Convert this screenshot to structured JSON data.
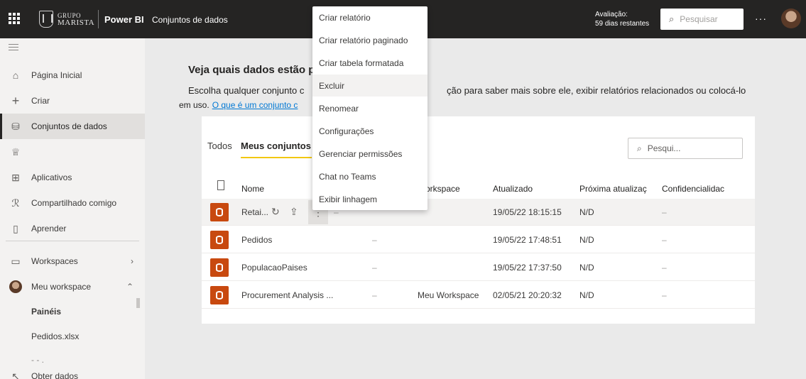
{
  "topbar": {
    "logo_line1": "GRUPO",
    "logo_line2": "MARISTA",
    "product": "Power BI",
    "breadcrumb": "Conjuntos de dados",
    "trial_line1": "Avaliação:",
    "trial_line2": "59 dias restantes",
    "search_placeholder": "Pesquisar",
    "more": "···"
  },
  "nav": {
    "items": [
      {
        "label": "Página Inicial"
      },
      {
        "label": "Criar"
      },
      {
        "label": "Conjuntos de dados"
      },
      {
        "label": ""
      },
      {
        "label": "Aplicativos"
      },
      {
        "label": "Compartilhado comigo"
      },
      {
        "label": "Aprender"
      },
      {
        "label": "Workspaces"
      },
      {
        "label": "Meu workspace"
      }
    ],
    "sub_items": [
      "Painéis",
      "Pedidos.xlsx",
      "- - ."
    ],
    "bottom": "Obter dados"
  },
  "main": {
    "title": "Veja quais dados estão p",
    "desc_part1": "Escolha qualquer conjunto c",
    "desc_part2": "ção para saber mais sobre ele, exibir relatórios relacionados ou colocá-lo",
    "desc_line2": "em uso.",
    "desc_link": "O que é um conjunto c",
    "tabs": [
      "Todos",
      "Meus conjuntos"
    ],
    "search_placeholder": "Pesqui...",
    "headers": {
      "name": "Nome",
      "workspace": "orkspace",
      "updated": "Atualizado",
      "next": "Próxima atualizaç",
      "sensitivity": "Confidencialidac"
    },
    "rows": [
      {
        "name": "Retai...",
        "owner": "–",
        "workspace": "",
        "updated": "19/05/22 18:15:15",
        "next": "N/D",
        "sensitivity": "–"
      },
      {
        "name": "Pedidos",
        "owner": "–",
        "workspace": "",
        "updated": "19/05/22 17:48:51",
        "next": "N/D",
        "sensitivity": "–"
      },
      {
        "name": "PopulacaoPaises",
        "owner": "–",
        "workspace": "",
        "updated": "19/05/22 17:37:50",
        "next": "N/D",
        "sensitivity": "–"
      },
      {
        "name": "Procurement Analysis ...",
        "owner": "–",
        "workspace": "Meu Workspace",
        "updated": "02/05/21 20:20:32",
        "next": "N/D",
        "sensitivity": "–"
      }
    ]
  },
  "menu": {
    "items": [
      "Criar relatório",
      "Criar relatório paginado",
      "Criar tabela formatada",
      "Excluir",
      "Renomear",
      "Configurações",
      "Gerenciar permissões",
      "Chat no Teams",
      "Exibir linhagem"
    ]
  },
  "colors": {
    "topbar": "#252423",
    "accent": "#f2c811",
    "dataset_icon": "#c8490f",
    "link": "#0078d4"
  },
  "icons": {
    "refresh": "refresh-icon",
    "share": "share-icon",
    "more": "more-vertical-icon"
  }
}
